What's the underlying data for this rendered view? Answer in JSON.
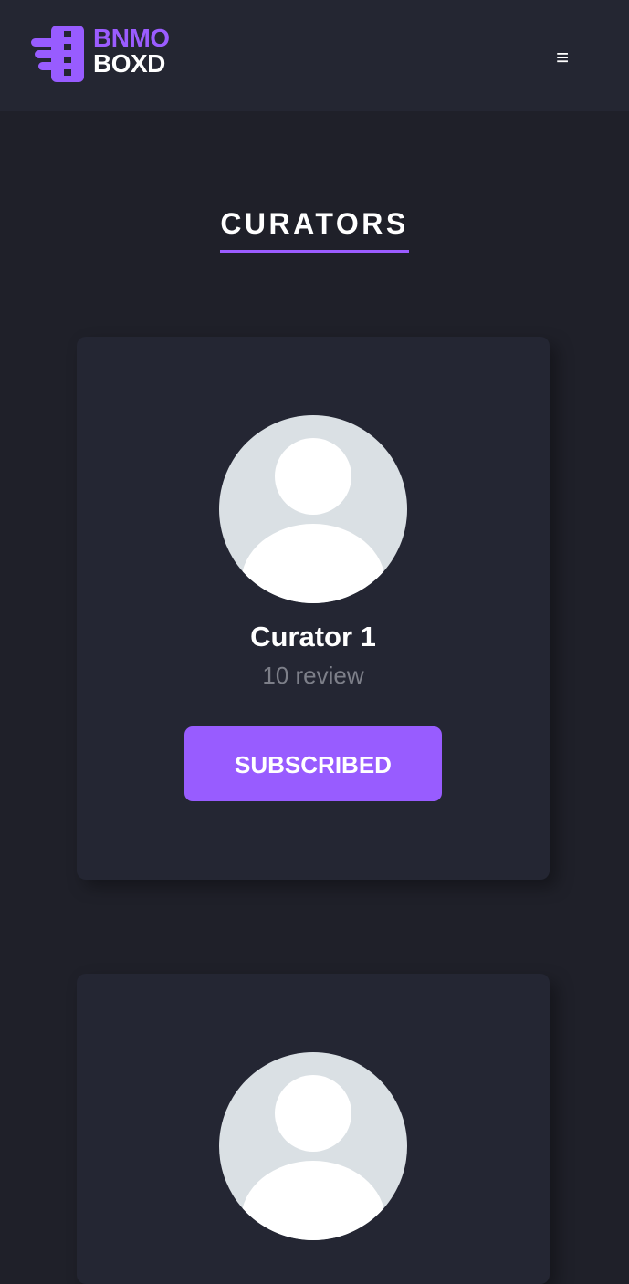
{
  "header": {
    "logo_line1": "BNMO",
    "logo_line2": "BOXD",
    "menu_icon": "≡"
  },
  "page": {
    "title": "CURATORS"
  },
  "curators": [
    {
      "name": "Curator 1",
      "reviews": "10 review",
      "button_label": "SUBSCRIBED"
    },
    {
      "name": "",
      "reviews": "",
      "button_label": ""
    }
  ],
  "colors": {
    "accent": "#985cff",
    "background": "#1f2029",
    "header_bg": "#242632",
    "card_bg": "#242633",
    "avatar_bg": "#dae0e4",
    "muted_text": "#7d7f89"
  }
}
